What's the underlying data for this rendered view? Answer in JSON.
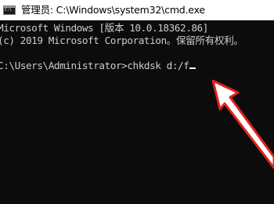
{
  "window": {
    "title": "管理员: C:\\Windows\\system32\\cmd.exe"
  },
  "console": {
    "lines": [
      "Microsoft Windows [版本 10.0.18362.86]",
      "(c) 2019 Microsoft Corporation。保留所有权利。",
      "C:\\Users\\Administrator>chkdsk d:/f"
    ]
  },
  "annotation": {
    "arrow_color": "#e0211b",
    "icon": "red-arrow-icon"
  }
}
